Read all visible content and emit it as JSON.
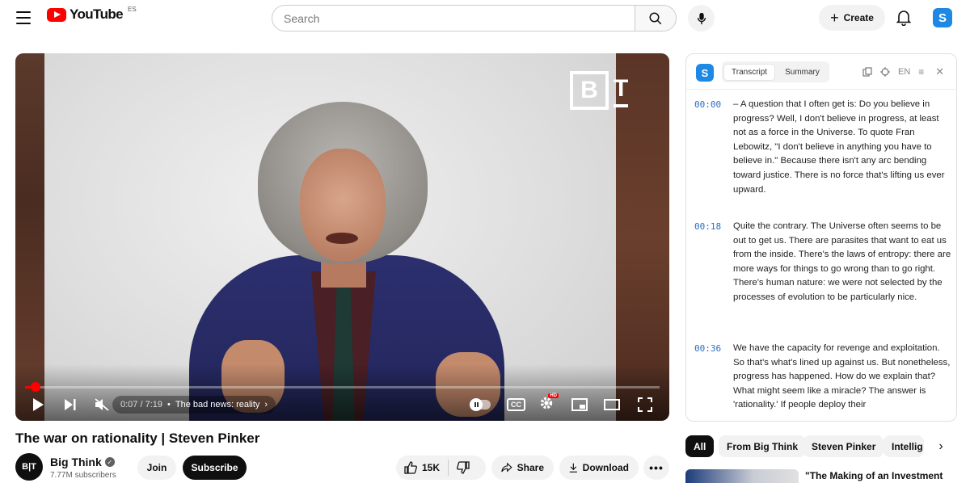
{
  "header": {
    "logo_text": "YouTube",
    "logo_country": "ES",
    "search_placeholder": "Search",
    "create_label": "Create",
    "avatar_letter": "S"
  },
  "player": {
    "watermark_b": "B",
    "watermark_t": "T",
    "time": "0:07 / 7:19",
    "chapter": "The bad news: reality",
    "progress_fraction": 0.016,
    "hd_badge": "HD",
    "cc_label": "CC"
  },
  "video": {
    "title": "The war on rationality | Steven Pinker",
    "channel": "Big Think",
    "channel_avatar": "B|T",
    "subscribers": "7.77M subscribers",
    "join_label": "Join",
    "subscribe_label": "Subscribe",
    "likes": "15K",
    "share_label": "Share",
    "download_label": "Download"
  },
  "transcript_panel": {
    "logo_letter": "S",
    "tabs": [
      {
        "label": "Transcript",
        "active": true
      },
      {
        "label": "Summary",
        "active": false
      }
    ],
    "language": "EN",
    "entries": [
      {
        "time": "00:00",
        "text": "– A question that I often get is: Do you believe in progress? Well, I don't believe in progress, at least not as a force in the Universe. To quote Fran Lebowitz, \"I don't believe in anything you have to believe in.\" Because there isn't any arc bending toward justice. There is no force that's lifting us ever upward."
      },
      {
        "time": "00:18",
        "text": "Quite the contrary. The Universe often seems to be out to get us. There are parasites that want to eat us from the inside. There's the laws of entropy: there are more ways for things to go wrong than to go right. There's human nature: we were not selected by the processes of evolution to be particularly nice."
      },
      {
        "time": "00:36",
        "text": "We have the capacity for revenge and exploitation. So that's what's lined up against us. But nonetheless, progress has happened. How do we explain that? What might seem like a miracle? The answer is 'rationality.' If people deploy their"
      }
    ]
  },
  "chips": [
    "All",
    "From Big Think",
    "Steven Pinker",
    "Intellig"
  ],
  "recommendation": {
    "title": "\"The Making of an Investment"
  }
}
